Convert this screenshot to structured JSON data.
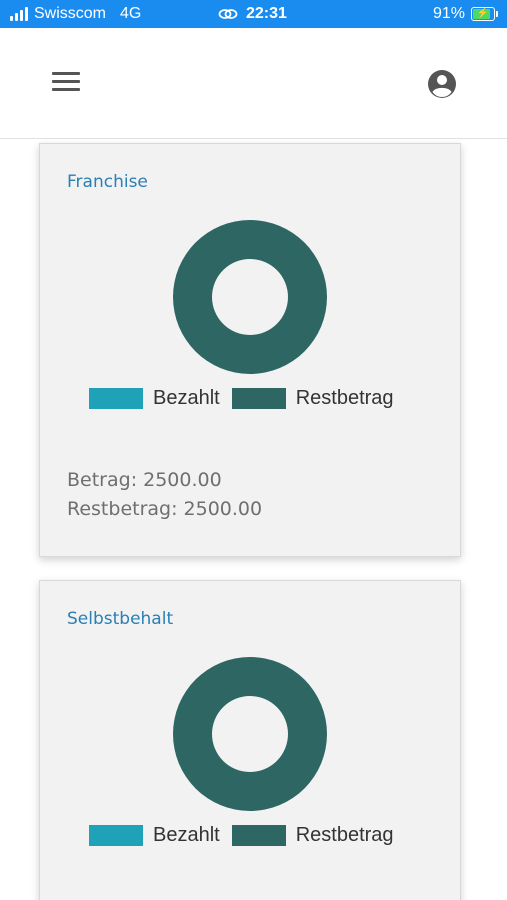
{
  "status_bar": {
    "carrier": "Swisscom",
    "network": "4G",
    "time": "22:31",
    "battery_percent_label": "91%",
    "battery_level": 0.91
  },
  "header": {
    "menu_icon": "hamburger-menu-icon",
    "account_icon": "account-circle-icon"
  },
  "colors": {
    "paid": "#1fa2b8",
    "remaining": "#2e6663",
    "title": "#2a7fb4",
    "status_bar": "#1a8cf0"
  },
  "cards": [
    {
      "title": "Franchise",
      "legend": {
        "paid": "Bezahlt",
        "remaining": "Restbetrag"
      },
      "amount_text": "Betrag: 2500.00",
      "remaining_text": "Restbetrag: 2500.00"
    },
    {
      "title": "Selbstbehalt",
      "legend": {
        "paid": "Bezahlt",
        "remaining": "Restbetrag"
      }
    }
  ],
  "chart_data": [
    {
      "type": "pie",
      "categories": [
        "Bezahlt",
        "Restbetrag"
      ],
      "values": [
        0,
        2500.0
      ]
    },
    {
      "type": "pie",
      "categories": [
        "Bezahlt",
        "Restbetrag"
      ],
      "values": [
        0,
        1
      ]
    }
  ]
}
